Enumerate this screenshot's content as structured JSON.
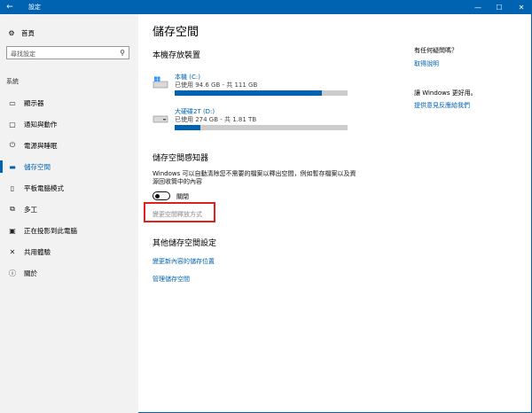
{
  "window": {
    "title": "設定",
    "back_icon": "←",
    "minimize": "—",
    "maximize": "☐",
    "close": "✕",
    "accent": "#0063b1"
  },
  "sidebar": {
    "home_label": "首頁",
    "search_placeholder": "尋找設定",
    "section_label": "系統",
    "items": [
      {
        "icon": "monitor-icon",
        "glyph": "▭",
        "label": "顯示器"
      },
      {
        "icon": "message-icon",
        "glyph": "▢",
        "label": "通知與動作"
      },
      {
        "icon": "power-icon",
        "glyph": "⏻",
        "label": "電源與睡眠"
      },
      {
        "icon": "storage-icon",
        "glyph": "▬",
        "label": "儲存空間",
        "active": true
      },
      {
        "icon": "tablet-icon",
        "glyph": "▯",
        "label": "平板電腦模式"
      },
      {
        "icon": "multitask-icon",
        "glyph": "⧉",
        "label": "多工"
      },
      {
        "icon": "project-icon",
        "glyph": "▣",
        "label": "正在投影到此電腦"
      },
      {
        "icon": "share-icon",
        "glyph": "✕",
        "label": "共用體驗"
      },
      {
        "icon": "info-icon",
        "glyph": "ⓘ",
        "label": "關於"
      }
    ]
  },
  "main": {
    "title": "儲存空間",
    "local_storage_heading": "本機存放裝置",
    "drives": [
      {
        "name": "本機 (C:)",
        "usage": "已使用 94.6 GB - 共 111 GB",
        "used_fraction": 0.852
      },
      {
        "name": "大硬碟2T (D:)",
        "usage": "已使用 274 GB - 共 1.81 TB",
        "used_fraction": 0.148
      }
    ],
    "sense_heading": "儲存空間感知器",
    "sense_desc": "Windows 可以自動清除您不需要的檔案以釋出空間，例如暫存檔案以及資源回收筒中的內容",
    "toggle_label": "關閉",
    "change_free_link": "變更空間釋放方式",
    "other_heading": "其他儲存空間設定",
    "change_save_link": "變更新內容的儲存位置",
    "manage_link": "管理儲存空間"
  },
  "right_panel": {
    "question_heading": "有任何疑問嗎？",
    "help_link": "取得說明",
    "better_heading": "讓 Windows 更好用。",
    "feedback_link": "提供意見反應給我們"
  }
}
